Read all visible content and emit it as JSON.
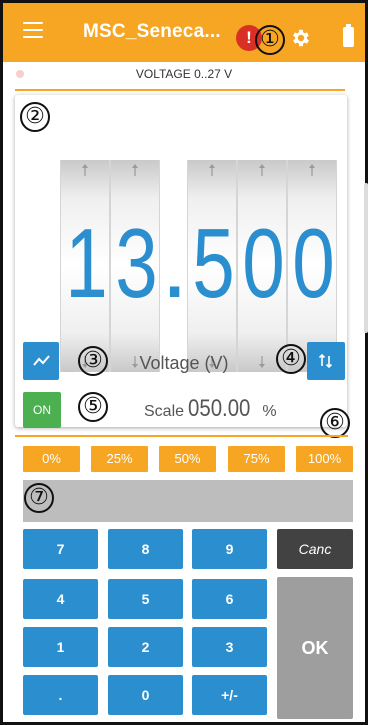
{
  "header": {
    "title": "MSC_Seneca...",
    "alert_badge": "!",
    "icons": [
      "menu-icon",
      "gear-icon",
      "battery-icon"
    ]
  },
  "status": {
    "range_label": "VOLTAGE 0..27 V"
  },
  "display": {
    "digits": [
      "1",
      "3",
      "5",
      "0",
      "0"
    ],
    "decimal_point": ".",
    "value": "13.500"
  },
  "controls": {
    "measure_label": "Voltage (V)",
    "on_label": "ON",
    "scale_label": "Scale",
    "scale_value": "050.00",
    "scale_unit": "%"
  },
  "percent_buttons": [
    "0%",
    "25%",
    "50%",
    "75%",
    "100%"
  ],
  "keypad": {
    "keys": [
      "7",
      "8",
      "9",
      "4",
      "5",
      "6",
      "1",
      "2",
      "3",
      ".",
      "0",
      "+/-"
    ],
    "cancel_label": "Canc",
    "ok_label": "OK"
  },
  "callouts": [
    "①",
    "②",
    "③",
    "④",
    "⑤",
    "⑥",
    "⑦"
  ],
  "colors": {
    "accent": "#f6a623",
    "primary": "#2b8fcf",
    "on_green": "#4caf50",
    "alert_red": "#d93025"
  }
}
